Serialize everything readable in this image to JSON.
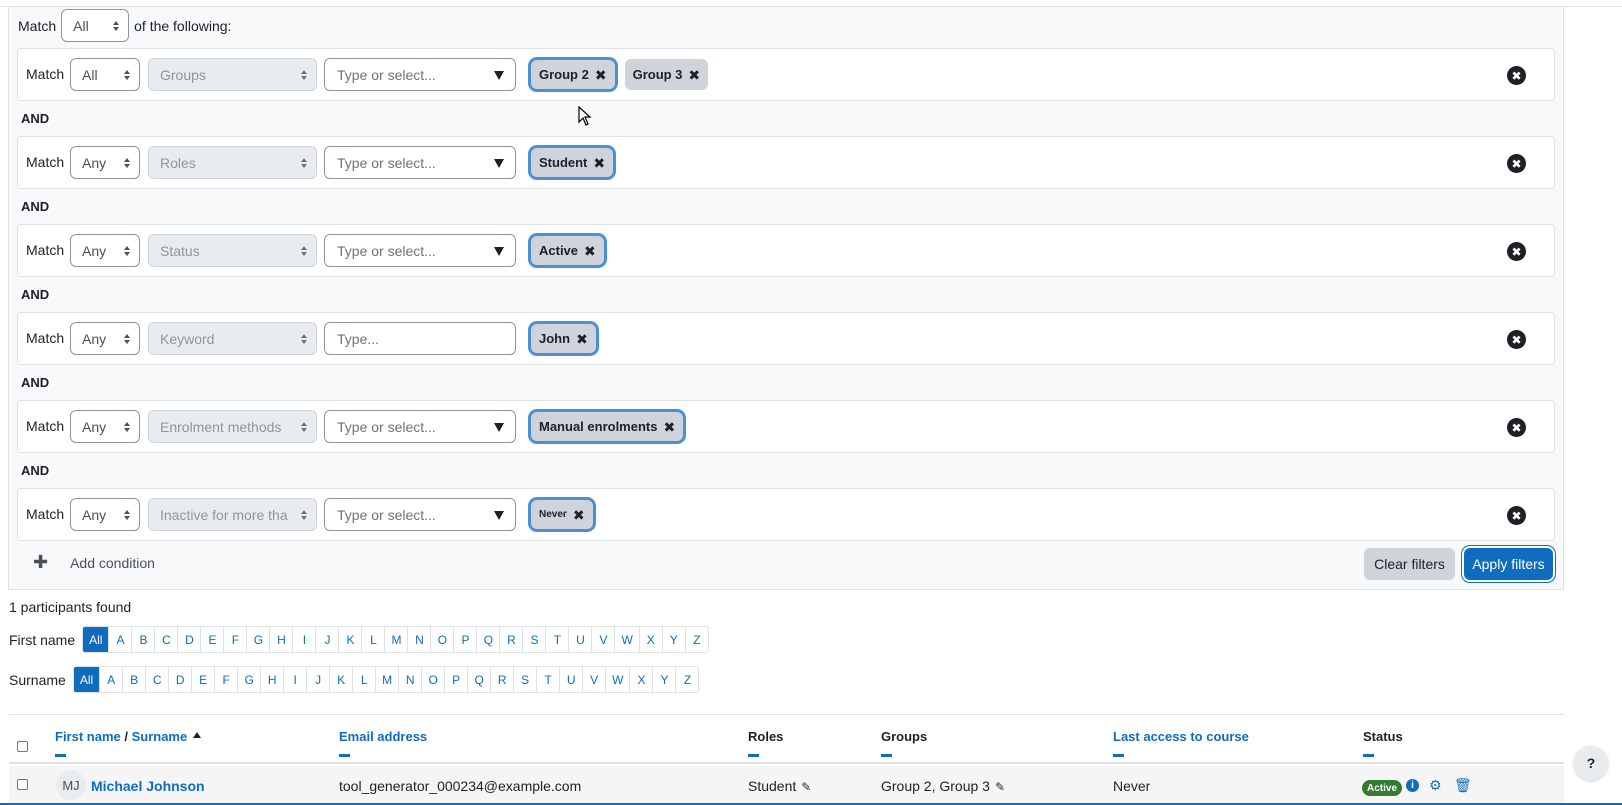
{
  "filter": {
    "match_label": "Match",
    "match_value": "All",
    "of_following": "of the following:",
    "conditions": [
      {
        "match": "Match",
        "join": "All",
        "type": "Groups",
        "input": "Type or select...",
        "chips": [
          "Group 2",
          "Group 3"
        ]
      },
      {
        "match": "Match",
        "join": "Any",
        "type": "Roles",
        "input": "Type or select...",
        "chips": [
          "Student"
        ]
      },
      {
        "match": "Match",
        "join": "Any",
        "type": "Status",
        "input": "Type or select...",
        "chips": [
          "Active"
        ]
      },
      {
        "match": "Match",
        "join": "Any",
        "type": "Keyword",
        "input": "Type...",
        "chips": [
          "John"
        ]
      },
      {
        "match": "Match",
        "join": "Any",
        "type": "Enrolment methods",
        "input": "Type or select...",
        "chips": [
          "Manual enrolments"
        ]
      },
      {
        "match": "Match",
        "join": "Any",
        "type": "Inactive for more than",
        "input": "Type or select...",
        "chips": [
          "Never"
        ]
      }
    ],
    "and_label": "AND",
    "remove_icon": "✖",
    "add_condition": "Add condition",
    "clear_filters": "Clear filters",
    "apply_filters": "Apply filters"
  },
  "results": {
    "found": "1 participants found",
    "firstname_label": "First name",
    "surname_label": "Surname",
    "letters": [
      "All",
      "A",
      "B",
      "C",
      "D",
      "E",
      "F",
      "G",
      "H",
      "I",
      "J",
      "K",
      "L",
      "M",
      "N",
      "O",
      "P",
      "Q",
      "R",
      "S",
      "T",
      "U",
      "V",
      "W",
      "X",
      "Y",
      "Z"
    ]
  },
  "table": {
    "headers": {
      "firstname": "First name",
      "sep": " / ",
      "surname": "Surname",
      "email": "Email address",
      "roles": "Roles",
      "groups": "Groups",
      "last_access": "Last access to course",
      "status": "Status"
    },
    "rows": [
      {
        "initials": "MJ",
        "name": "Michael Johnson",
        "email": "tool_generator_000234@example.com",
        "roles": "Student",
        "groups": "Group 2, Group 3",
        "last_access": "Never",
        "status": "Active"
      }
    ]
  },
  "help": "?",
  "colors": {
    "accent": "#0f6cbf",
    "success": "#357a32"
  }
}
